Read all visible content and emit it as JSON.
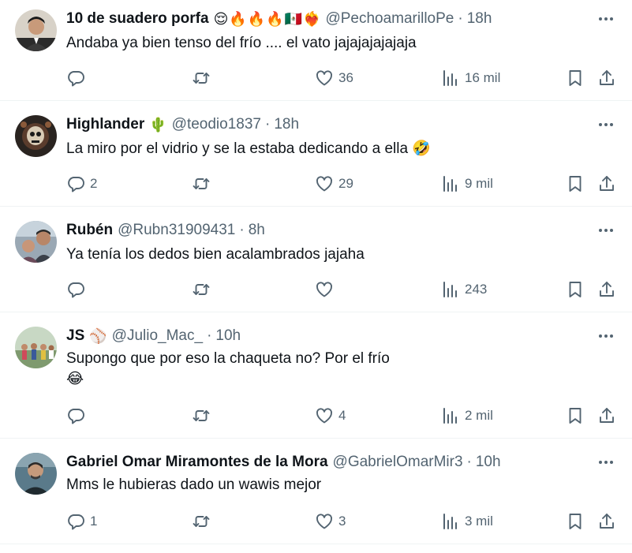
{
  "tweets": [
    {
      "name": "10 de suadero porfa",
      "emojis": [
        "😌",
        "🔥",
        "🔥",
        "🔥",
        "🇲🇽",
        "❤️‍🔥"
      ],
      "handle": "@PechoamarilloPe",
      "time": "18h",
      "text": "Andaba ya bien tenso del frío .... el vato jajajajajajaja",
      "text2": "",
      "replies": "",
      "retweets": "",
      "likes": "36",
      "views": "16 mil"
    },
    {
      "name": "Highlander",
      "emojis": [
        "🌵"
      ],
      "handle": "@teodio1837",
      "time": "18h",
      "text": "La miro por el vidrio y se la estaba dedicando a ella 🤣",
      "text2": "",
      "replies": "2",
      "retweets": "",
      "likes": "29",
      "views": "9 mil"
    },
    {
      "name": "Rubén",
      "emojis": [],
      "handle": "@Rubn31909431",
      "time": "8h",
      "text": "Ya tenía los dedos bien acalambrados jajaha",
      "text2": "",
      "replies": "",
      "retweets": "",
      "likes": "",
      "views": "243"
    },
    {
      "name": "JS",
      "emojis": [
        "⚾"
      ],
      "handle": "@Julio_Mac_",
      "time": "10h",
      "text": "Supongo que por eso la chaqueta no? Por el frío",
      "text2": "😂",
      "replies": "",
      "retweets": "",
      "likes": "4",
      "views": "2 mil"
    },
    {
      "name": "Gabriel Omar Miramontes de la Mora",
      "emojis": [],
      "handle": "@GabrielOmarMir3",
      "time": "10h",
      "text": "Mms le hubieras dado un wawis mejor",
      "text2": "",
      "replies": "1",
      "retweets": "",
      "likes": "3",
      "views": "3 mil"
    }
  ],
  "separator": "·",
  "colors": {
    "text": "#0f1419",
    "secondary": "#536471",
    "divider": "#eff3f4"
  }
}
